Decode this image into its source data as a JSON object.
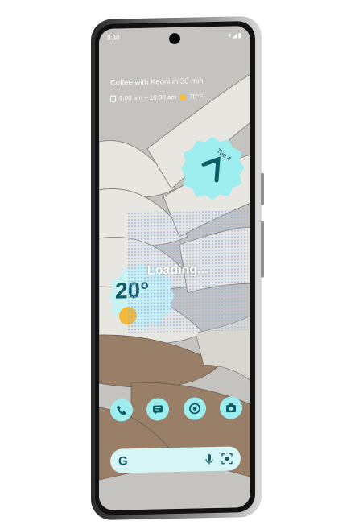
{
  "status_bar": {
    "time": "9:30"
  },
  "at_a_glance": {
    "event_title": "Coffee with Keoni in 30 min",
    "event_time": "9:00 am – 10:00 am",
    "weather_mini": "70°F"
  },
  "clock_widget": {
    "date": "Tue 4",
    "time_digit": "7"
  },
  "weather_widget": {
    "temperature": "20°"
  },
  "overlay": {
    "loading_text": "Loading..."
  },
  "dock": {
    "apps": [
      {
        "name": "phone-icon"
      },
      {
        "name": "messages-icon"
      },
      {
        "name": "chrome-icon"
      },
      {
        "name": "camera-icon"
      }
    ]
  },
  "search_bar": {
    "logo": "G"
  },
  "colors": {
    "accent": "#9eeef0",
    "search_bg": "#d5f5f6",
    "icon_dark": "#0d5c66",
    "sun": "#f2b93b"
  }
}
